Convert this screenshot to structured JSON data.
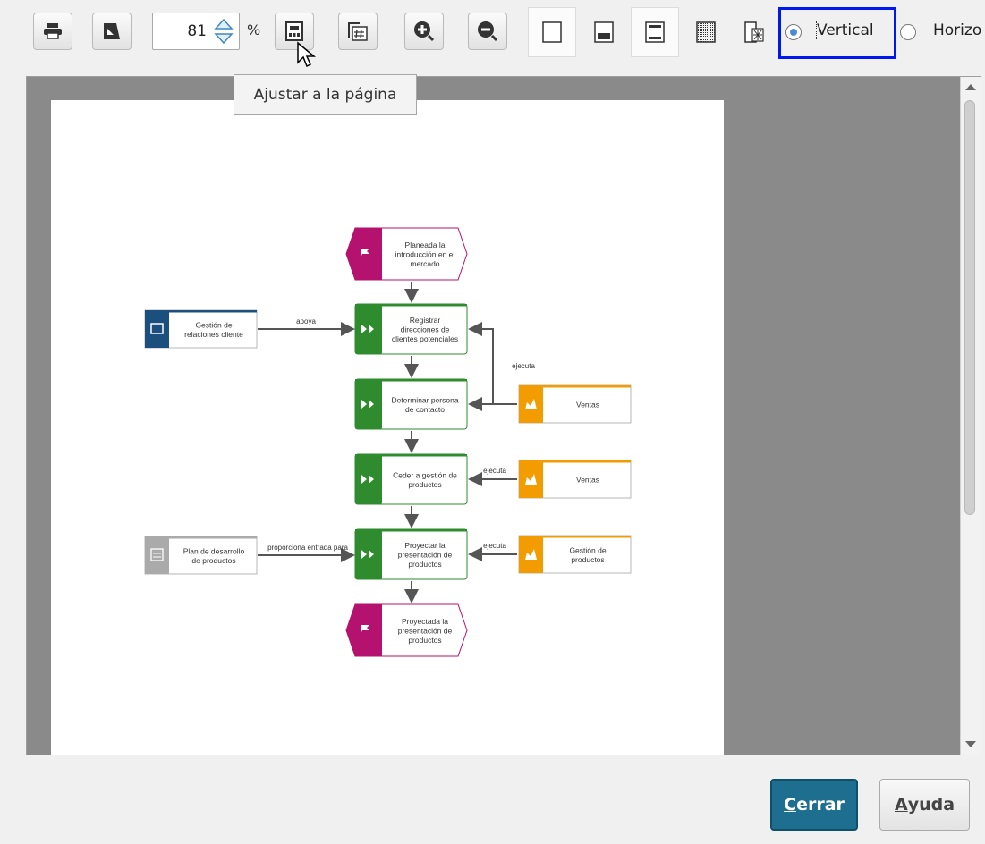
{
  "toolbar": {
    "zoom_value": "81",
    "zoom_unit": "%",
    "orientation_vertical": "Vertical",
    "orientation_horizontal": "Horizo",
    "tooltip": "Ajustar a la página"
  },
  "dialog": {
    "close_label": "Cerrar",
    "close_mnemonic": "C",
    "close_rest": "errar",
    "help_label": "Ayuda",
    "help_mnemonic": "A",
    "help_rest": "yuda"
  },
  "diagram": {
    "colors": {
      "event": "#b4126e",
      "function": "#2e8b2e",
      "app_system": "#1b4f7d",
      "org_unit": "#f29c00",
      "document": "#aaaaaa"
    },
    "event_start": [
      "Planeada la",
      "introducción en el",
      "mercado"
    ],
    "event_end": [
      "Proyectada la",
      "presentación de",
      "productos"
    ],
    "functions": [
      [
        "Registrar",
        "direcciones de",
        "clientes potenciales"
      ],
      [
        "Determinar persona",
        "de contacto"
      ],
      [
        "Ceder a gestión de",
        "productos"
      ],
      [
        "Proyectar la",
        "presentación de",
        "productos"
      ]
    ],
    "app_system": [
      "Gestión de",
      "relaciones cliente"
    ],
    "document": [
      "Plan de desarrollo",
      "de productos"
    ],
    "org_units": [
      [
        "Ventas"
      ],
      [
        "Ventas"
      ],
      [
        "Gestión de",
        "productos"
      ]
    ],
    "edge_labels": {
      "supports": "apoya",
      "executes_1": "ejecuta",
      "executes_2": "ejecuta",
      "executes_3": "ejecuta",
      "input": "proporciona entrada para"
    }
  }
}
